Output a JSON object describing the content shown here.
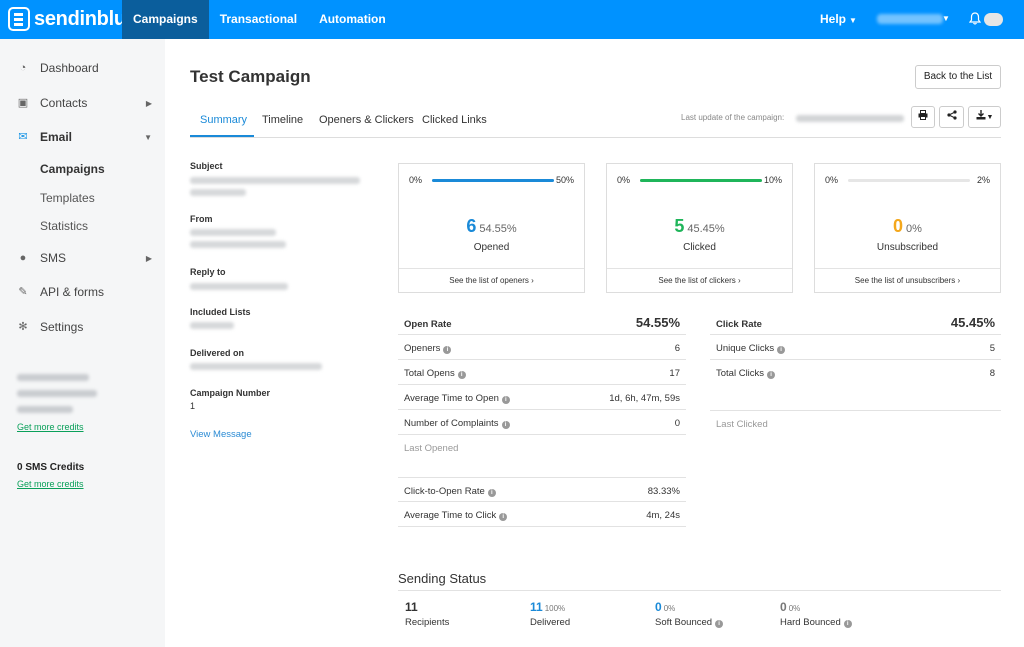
{
  "brand": "sendinblue",
  "nav": [
    "Campaigns",
    "Transactional",
    "Automation"
  ],
  "help": "Help",
  "sidebar": {
    "items": [
      "Dashboard",
      "Contacts",
      "Email",
      "SMS",
      "API & forms",
      "Settings"
    ],
    "email_sub": [
      "Campaigns",
      "Templates",
      "Statistics"
    ],
    "get_more_credits": "Get more credits",
    "sms_credits": "0 SMS Credits"
  },
  "campaign": {
    "title": "Test Campaign",
    "back_button": "Back to the List",
    "tabs": [
      "Summary",
      "Timeline",
      "Openers & Clickers",
      "Clicked Links"
    ],
    "last_update_label": "Last update of the campaign:"
  },
  "info": {
    "subject": "Subject",
    "from": "From",
    "reply_to": "Reply to",
    "included_lists": "Included Lists",
    "delivered_on": "Delivered on",
    "campaign_number": "Campaign Number",
    "campaign_number_value": "1",
    "view_message": "View Message"
  },
  "cards": [
    {
      "min": "0%",
      "max": "50%",
      "count": "6",
      "percent": "54.55%",
      "caption": "Opened",
      "link": "See the list of openers ›",
      "color": "#1a8ad8",
      "fill_fraction": 1.0
    },
    {
      "min": "0%",
      "max": "10%",
      "count": "5",
      "percent": "45.45%",
      "caption": "Clicked",
      "link": "See the list of clickers ›",
      "color": "#1fb55a",
      "fill_fraction": 1.0
    },
    {
      "min": "0%",
      "max": "2%",
      "count": "0",
      "percent": "0%",
      "caption": "Unsubscribed",
      "link": "See the list of unsubscribers ›",
      "color": "#f4a71b",
      "fill_fraction": 0
    }
  ],
  "open_stats": {
    "head_label": "Open Rate",
    "head_value": "54.55%",
    "rows": [
      {
        "label": "Openers",
        "value": "6"
      },
      {
        "label": "Total Opens",
        "value": "17"
      },
      {
        "label": "Average Time to Open",
        "value": "1d, 6h, 47m, 59s"
      },
      {
        "label": "Number of Complaints",
        "value": "0"
      }
    ],
    "last_opened": "Last Opened",
    "ctor_label": "Click-to-Open Rate",
    "ctor_value": "83.33%",
    "avg_click_label": "Average Time to Click",
    "avg_click_value": "4m, 24s"
  },
  "click_stats": {
    "head_label": "Click Rate",
    "head_value": "45.45%",
    "rows": [
      {
        "label": "Unique Clicks",
        "value": "5"
      },
      {
        "label": "Total Clicks",
        "value": "8"
      }
    ],
    "last_clicked": "Last Clicked"
  },
  "sending_status": {
    "title": "Sending Status",
    "items": [
      {
        "number": "11",
        "percent": "",
        "caption": "Recipients",
        "color": "#333333"
      },
      {
        "number": "11",
        "percent": "100%",
        "caption": "Delivered",
        "color": "#1a8ad8"
      },
      {
        "number": "0",
        "percent": "0%",
        "caption": "Soft Bounced",
        "color": "#1a8ad8"
      },
      {
        "number": "0",
        "percent": "0%",
        "caption": "Hard Bounced",
        "color": "#777777"
      }
    ]
  }
}
